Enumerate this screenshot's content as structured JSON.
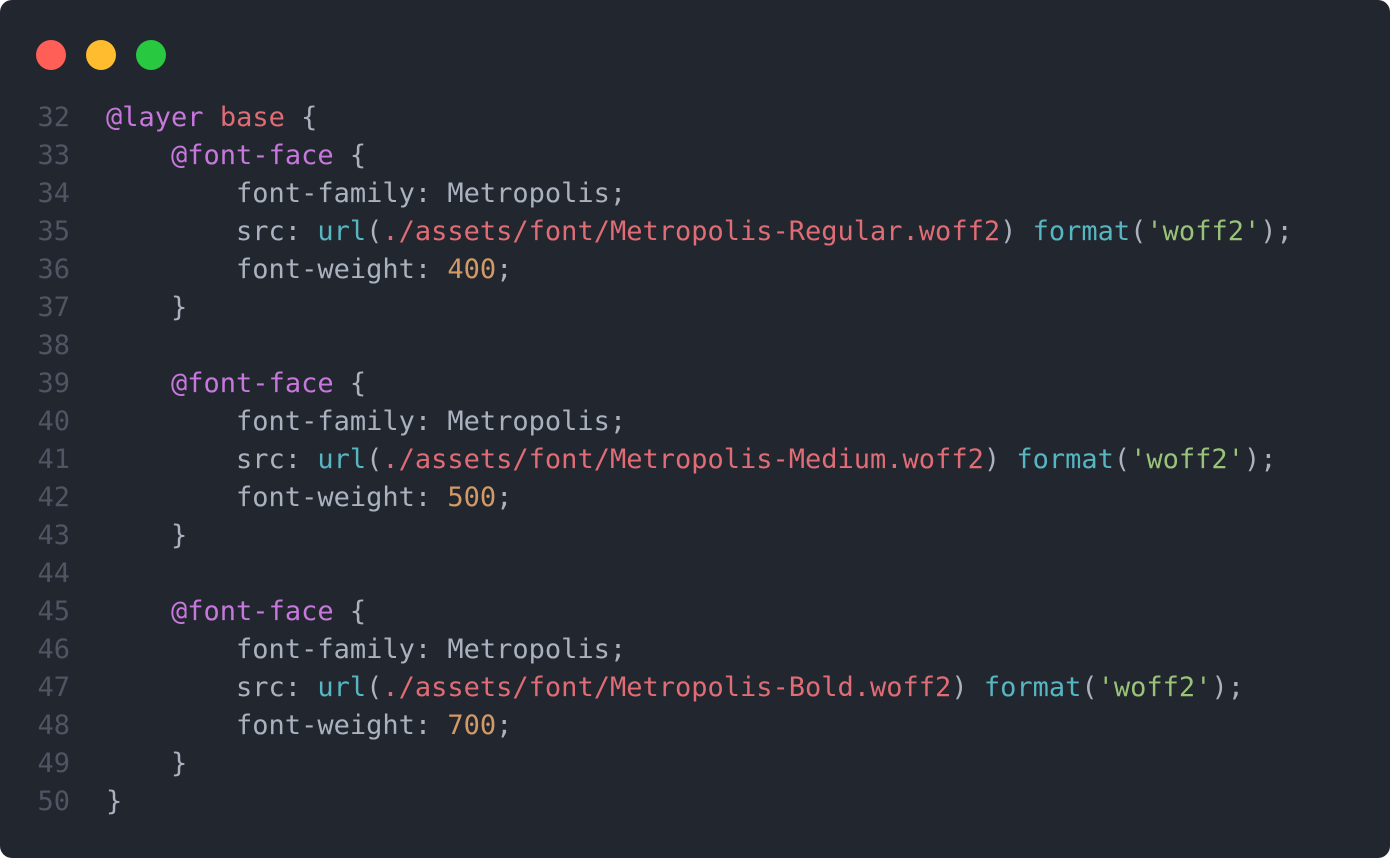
{
  "window": {
    "controls": [
      {
        "name": "close",
        "color": "#ff5f57"
      },
      {
        "name": "minimize",
        "color": "#febc2e"
      },
      {
        "name": "zoom",
        "color": "#28c840"
      }
    ]
  },
  "theme": {
    "background": "#22262e",
    "line_number": "#4f5562",
    "default": "#abb2bf",
    "keyword": "#c678dd",
    "selector": "#e06c75",
    "function": "#56b6c2",
    "path": "#e06c75",
    "string": "#98c379",
    "number": "#d19a66"
  },
  "editor": {
    "language": "css",
    "lines": [
      {
        "num": "32",
        "tokens": [
          {
            "t": "keyword",
            "v": "@layer"
          },
          {
            "t": "default",
            "v": " "
          },
          {
            "t": "selector",
            "v": "base"
          },
          {
            "t": "default",
            "v": " {"
          }
        ]
      },
      {
        "num": "33",
        "tokens": [
          {
            "t": "default",
            "v": "    "
          },
          {
            "t": "keyword",
            "v": "@font-face"
          },
          {
            "t": "default",
            "v": " {"
          }
        ]
      },
      {
        "num": "34",
        "tokens": [
          {
            "t": "default",
            "v": "        font-family: Metropolis;"
          }
        ]
      },
      {
        "num": "35",
        "tokens": [
          {
            "t": "default",
            "v": "        src: "
          },
          {
            "t": "func",
            "v": "url"
          },
          {
            "t": "default",
            "v": "("
          },
          {
            "t": "path",
            "v": "./assets/font/Metropolis-Regular.woff2"
          },
          {
            "t": "default",
            "v": ") "
          },
          {
            "t": "func",
            "v": "format"
          },
          {
            "t": "default",
            "v": "("
          },
          {
            "t": "string",
            "v": "'woff2'"
          },
          {
            "t": "default",
            "v": ");"
          }
        ]
      },
      {
        "num": "36",
        "tokens": [
          {
            "t": "default",
            "v": "        font-weight: "
          },
          {
            "t": "number",
            "v": "400"
          },
          {
            "t": "default",
            "v": ";"
          }
        ]
      },
      {
        "num": "37",
        "tokens": [
          {
            "t": "default",
            "v": "    }"
          }
        ]
      },
      {
        "num": "38",
        "tokens": []
      },
      {
        "num": "39",
        "tokens": [
          {
            "t": "default",
            "v": "    "
          },
          {
            "t": "keyword",
            "v": "@font-face"
          },
          {
            "t": "default",
            "v": " {"
          }
        ]
      },
      {
        "num": "40",
        "tokens": [
          {
            "t": "default",
            "v": "        font-family: Metropolis;"
          }
        ]
      },
      {
        "num": "41",
        "tokens": [
          {
            "t": "default",
            "v": "        src: "
          },
          {
            "t": "func",
            "v": "url"
          },
          {
            "t": "default",
            "v": "("
          },
          {
            "t": "path",
            "v": "./assets/font/Metropolis-Medium.woff2"
          },
          {
            "t": "default",
            "v": ") "
          },
          {
            "t": "func",
            "v": "format"
          },
          {
            "t": "default",
            "v": "("
          },
          {
            "t": "string",
            "v": "'woff2'"
          },
          {
            "t": "default",
            "v": ");"
          }
        ]
      },
      {
        "num": "42",
        "tokens": [
          {
            "t": "default",
            "v": "        font-weight: "
          },
          {
            "t": "number",
            "v": "500"
          },
          {
            "t": "default",
            "v": ";"
          }
        ]
      },
      {
        "num": "43",
        "tokens": [
          {
            "t": "default",
            "v": "    }"
          }
        ]
      },
      {
        "num": "44",
        "tokens": []
      },
      {
        "num": "45",
        "tokens": [
          {
            "t": "default",
            "v": "    "
          },
          {
            "t": "keyword",
            "v": "@font-face"
          },
          {
            "t": "default",
            "v": " {"
          }
        ]
      },
      {
        "num": "46",
        "tokens": [
          {
            "t": "default",
            "v": "        font-family: Metropolis;"
          }
        ]
      },
      {
        "num": "47",
        "tokens": [
          {
            "t": "default",
            "v": "        src: "
          },
          {
            "t": "func",
            "v": "url"
          },
          {
            "t": "default",
            "v": "("
          },
          {
            "t": "path",
            "v": "./assets/font/Metropolis-Bold.woff2"
          },
          {
            "t": "default",
            "v": ") "
          },
          {
            "t": "func",
            "v": "format"
          },
          {
            "t": "default",
            "v": "("
          },
          {
            "t": "string",
            "v": "'woff2'"
          },
          {
            "t": "default",
            "v": ");"
          }
        ]
      },
      {
        "num": "48",
        "tokens": [
          {
            "t": "default",
            "v": "        font-weight: "
          },
          {
            "t": "number",
            "v": "700"
          },
          {
            "t": "default",
            "v": ";"
          }
        ]
      },
      {
        "num": "49",
        "tokens": [
          {
            "t": "default",
            "v": "    }"
          }
        ]
      },
      {
        "num": "50",
        "tokens": [
          {
            "t": "default",
            "v": "}"
          }
        ]
      }
    ]
  }
}
